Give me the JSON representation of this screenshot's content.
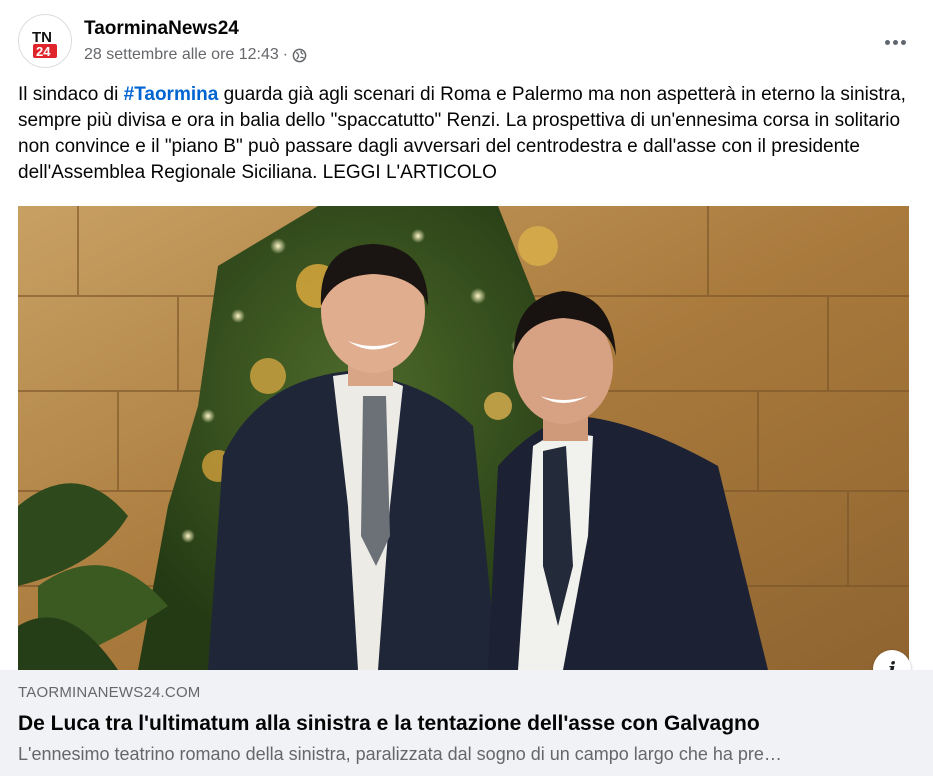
{
  "post": {
    "page_name": "TaorminaNews24",
    "timestamp": "28 settembre alle ore 12:43",
    "separator": "·",
    "privacy_icon": "globe-icon",
    "logo": {
      "line1": "TN",
      "line2": "24",
      "accent": "#e0242b"
    },
    "text": {
      "before_hashtag": "Il sindaco di ",
      "hashtag": "#Taormina",
      "after_hashtag": " guarda già agli scenari di Roma e Palermo ma non aspetterà in eterno la sinistra, sempre più divisa e ora in balia dello \"spaccatutto\" Renzi. La prospettiva di un'ennesima corsa in solitario non convince e il \"piano B\" può passare dagli avversari del centrodestra e dall'asse con il presidente dell'Assemblea Regionale Siciliana. LEGGI L'ARTICOLO"
    },
    "more_icon": "more-horizontal-icon"
  },
  "link": {
    "domain": "TAORMINANEWS24.COM",
    "title": "De Luca tra l'ultimatum alla sinistra e la tentazione dell'asse con Galvagno",
    "description": "L'ennesimo teatrino romano della sinistra, paralizzata dal sogno di un campo largo che ha pre…",
    "info_label": "i"
  },
  "colors": {
    "hashtag": "#0064d1",
    "secondary_text": "#65676b",
    "card_bg": "#f0f2f5"
  }
}
